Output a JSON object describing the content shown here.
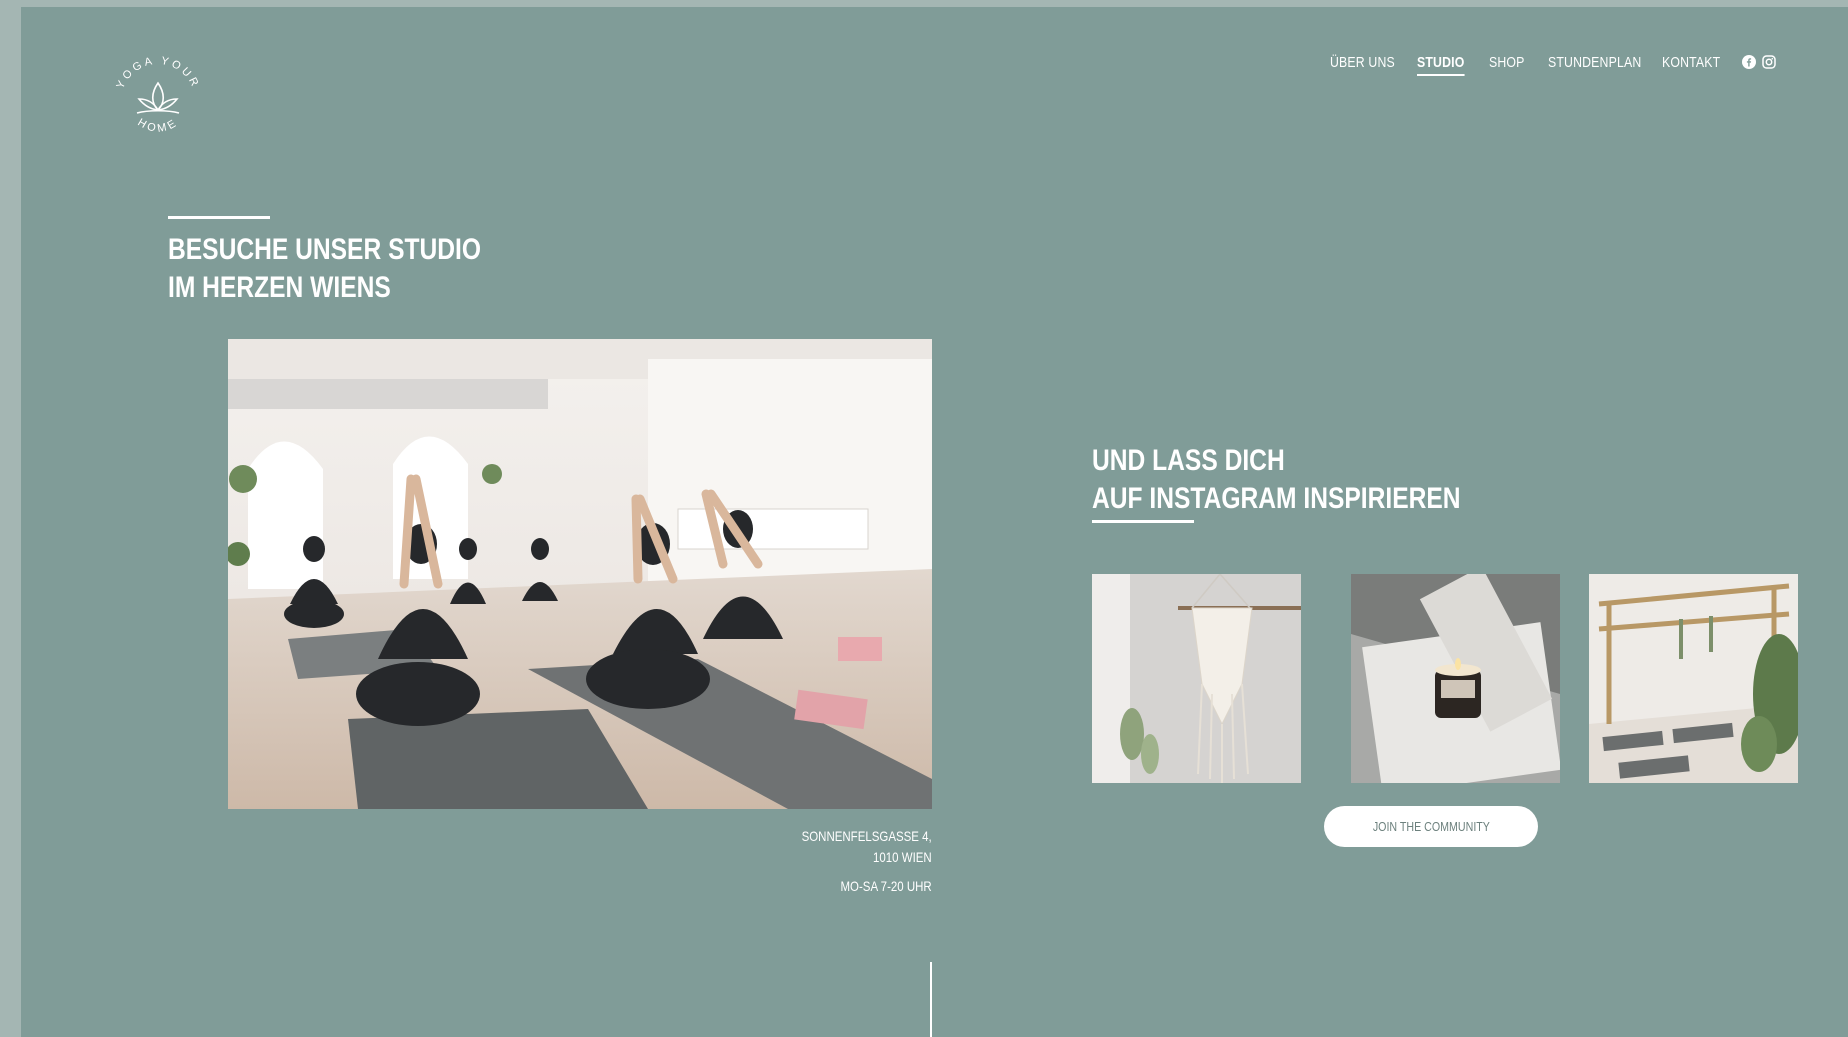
{
  "brand": {
    "logo_top": "YOGA YOUR",
    "logo_bottom": "HOME"
  },
  "nav": {
    "items": [
      {
        "label": "ÜBER UNS",
        "active": false
      },
      {
        "label": "STUDIO",
        "active": true
      },
      {
        "label": "SHOP",
        "active": false
      },
      {
        "label": "STUNDENPLAN",
        "active": false
      },
      {
        "label": "KONTAKT",
        "active": false
      }
    ],
    "social": [
      "facebook-icon",
      "instagram-icon"
    ]
  },
  "studio": {
    "heading_line1": "BESUCHE UNSER STUDIO",
    "heading_line2": "IM HERZEN WIENS",
    "address_line1": "SONNENFELSGASSE 4,",
    "address_line2": "1010 WIEN",
    "hours": "MO-SA 7-20 UHR"
  },
  "instagram": {
    "heading_line1": "UND LASS DICH",
    "heading_line2": "AUF INSTAGRAM INSPIRIEREN",
    "cta_label": "JOIN THE COMMUNITY"
  },
  "colors": {
    "page_bg": "#809c98",
    "outer_bg": "#a4b6b3",
    "text": "#ffffff"
  }
}
